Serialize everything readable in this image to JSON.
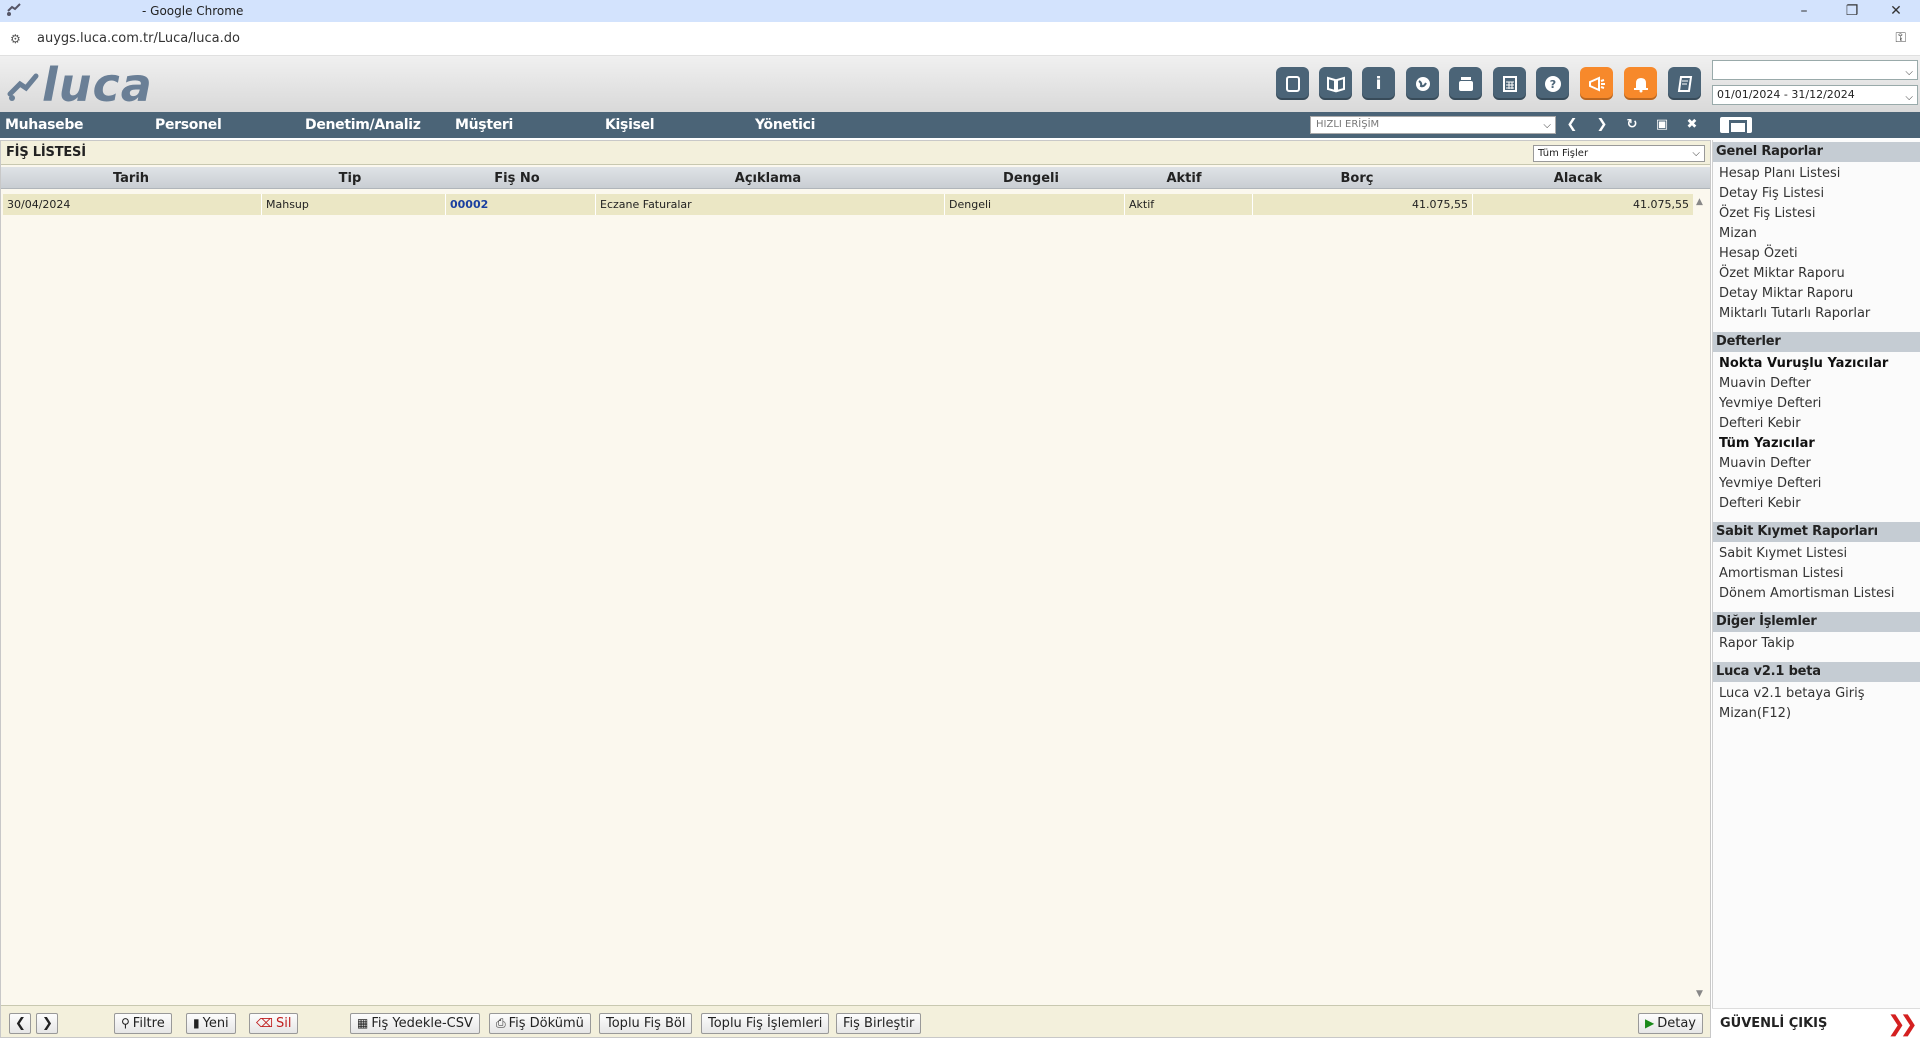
{
  "browser": {
    "window_title": "- Google Chrome",
    "url": "auygs.luca.com.tr/Luca/luca.do"
  },
  "header": {
    "logo_text": "luca",
    "date_range": "01/01/2024 - 31/12/2024",
    "top_select_value": "",
    "icons": [
      "note-icon",
      "book-icon",
      "info-icon",
      "globe-icon",
      "youtube-icon",
      "calculator-icon",
      "help-icon",
      "megaphone-icon",
      "bell-icon",
      "notebook-icon"
    ]
  },
  "nav": {
    "items": [
      "Muhasebe",
      "Personel",
      "Denetim/Analiz",
      "Müşteri",
      "Kişisel",
      "Yönetici"
    ],
    "quick_access_placeholder": "HIZLI ERİŞİM"
  },
  "panel": {
    "title": "FİŞ LİSTESİ",
    "filter_value": "Tüm Fişler"
  },
  "table": {
    "columns": [
      "Tarih",
      "Tip",
      "Fiş No",
      "Açıklama",
      "Dengeli",
      "Aktif",
      "Borç",
      "Alacak"
    ],
    "rows": [
      [
        "30/04/2024",
        "Mahsup",
        "00002",
        "Eczane Faturalar",
        "Dengeli",
        "Aktif",
        "41.075,55",
        "41.075,55"
      ]
    ]
  },
  "toolbar": {
    "filter": "Filtre",
    "new": "Yeni",
    "delete": "Sil",
    "backup_csv": "Fiş Yedekle-CSV",
    "dump": "Fiş Dökümü",
    "bulk_split": "Toplu Fiş Böl",
    "bulk_ops": "Toplu Fiş İşlemleri",
    "merge": "Fiş Birleştir",
    "detail": "Detay"
  },
  "sidebar": {
    "general_reports": {
      "title": "Genel Raporlar",
      "items": [
        "Hesap Planı Listesi",
        "Detay Fiş Listesi",
        "Özet Fiş Listesi",
        "Mizan",
        "Hesap Özeti",
        "Özet Miktar Raporu",
        "Detay Miktar Raporu",
        "Miktarlı Tutarlı Raporlar"
      ]
    },
    "books": {
      "title": "Defterler",
      "items": [
        "Nokta Vuruşlu Yazıcılar",
        "Muavin Defter",
        "Yevmiye Defteri",
        "Defteri Kebir",
        "Tüm Yazıcılar",
        "Muavin Defter",
        "Yevmiye Defteri",
        "Defteri Kebir"
      ]
    },
    "fixed_assets": {
      "title": "Sabit Kıymet Raporları",
      "items": [
        "Sabit Kıymet Listesi",
        "Amortisman Listesi",
        "Dönem Amortisman Listesi"
      ]
    },
    "other": {
      "title": "Diğer İşlemler",
      "items": [
        "Rapor Takip"
      ]
    },
    "beta": {
      "title": "Luca v2.1 beta",
      "items": [
        "Luca v2.1 betaya Giriş",
        "Mizan(F12)"
      ]
    },
    "logout": "GÜVENLİ ÇIKIŞ"
  }
}
